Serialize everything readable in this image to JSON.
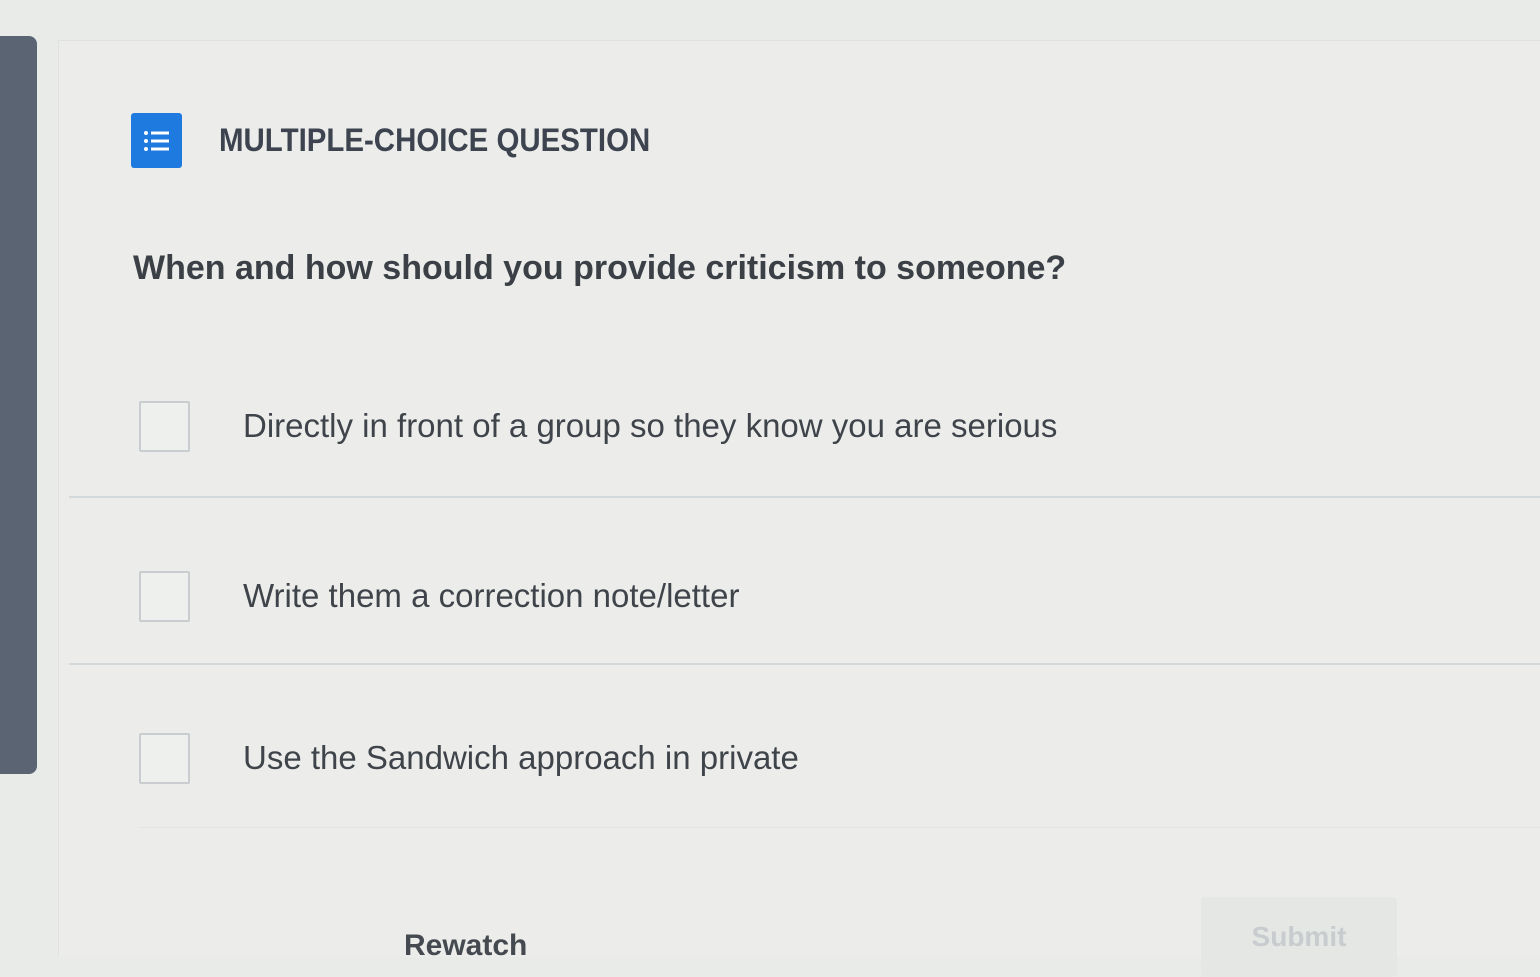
{
  "question_card": {
    "type_title": "MULTIPLE-CHOICE QUESTION",
    "type_icon": "list-icon",
    "question": "When and how should you provide criticism to someone?",
    "options": [
      {
        "label": "Directly in front of a group so they know you are serious",
        "checked": false
      },
      {
        "label": "Write them a correction note/letter",
        "checked": false
      },
      {
        "label": "Use the Sandwich approach in private",
        "checked": false
      }
    ]
  },
  "footer": {
    "rewatch_label": "Rewatch",
    "submit_label": "Submit",
    "submit_enabled": false
  },
  "colors": {
    "accent": "#1f7ae0",
    "sidebar": "#5a6473",
    "background": "#e9ebe8"
  }
}
